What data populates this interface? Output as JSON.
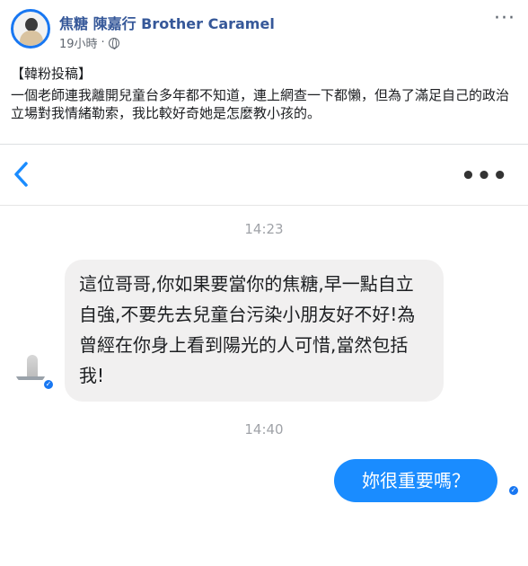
{
  "post": {
    "author": "焦糖 陳嘉行 Brother Caramel",
    "time": "19小時",
    "separator": "·",
    "tag": "【韓粉投稿】",
    "text": "一個老師連我離開兒童台多年都不知道，連上網查一下都懶，但為了滿足自己的政治立場對我情緒勒索，我比較好奇她是怎麼教小孩的。",
    "more_icon": "more-horizontal-icon"
  },
  "messenger": {
    "back_icon": "chevron-left-icon",
    "more_icon": "more-horizontal-icon",
    "messages": [
      {
        "time": "14:23",
        "from": "contact",
        "text": "這位哥哥,你如果要當你的焦糖,早一點自立自強,不要先去兒童台污染小朋友好不好!為曾經在你身上看到陽光的人可惜,當然包括我!"
      },
      {
        "time": "14:40",
        "from": "me",
        "text": "妳很重要嗎？"
      }
    ],
    "colors": {
      "outgoing": "#1a8cff",
      "incoming": "#f1f0f0",
      "verified": "#1877f2"
    }
  }
}
